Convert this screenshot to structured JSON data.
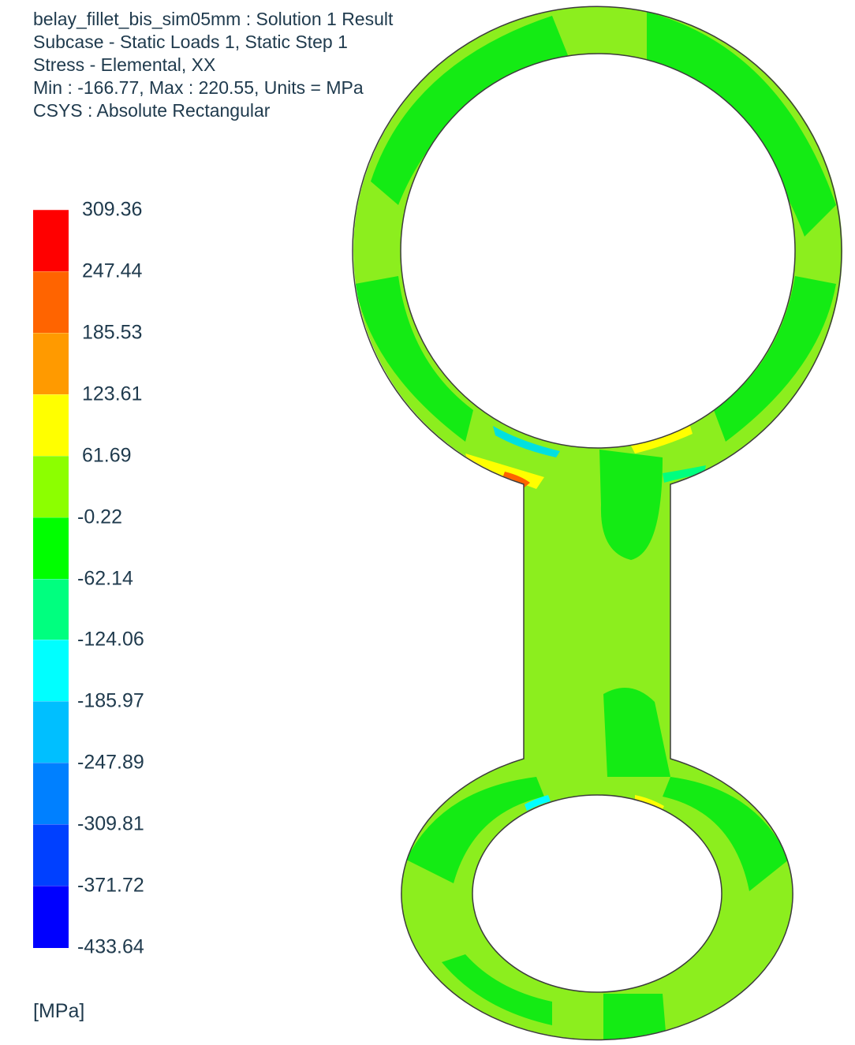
{
  "header": {
    "line1": "belay_fillet_bis_sim05mm : Solution 1 Result",
    "line2": "Subcase - Static Loads 1, Static Step 1",
    "line3": "Stress - Elemental, XX",
    "line4": "Min : -166.77, Max : 220.55, Units = MPa",
    "line5": "CSYS : Absolute Rectangular"
  },
  "legend": {
    "ticks": [
      "309.36",
      "247.44",
      "185.53",
      "123.61",
      "61.69",
      "-0.22",
      "-62.14",
      "-124.06",
      "-185.97",
      "-247.89",
      "-309.81",
      "-371.72",
      "-433.64"
    ],
    "colors": [
      "#ff0000",
      "#ff6400",
      "#ff9a00",
      "#ffff00",
      "#8cff00",
      "#00ff00",
      "#00ff7f",
      "#00ffff",
      "#00bfff",
      "#0080ff",
      "#0040ff",
      "#0000ff"
    ],
    "units": "[MPa]"
  },
  "model": {
    "body_color": "#8cee1e",
    "band_color": "#14eb14",
    "outline_color": "#3c3c3c"
  }
}
